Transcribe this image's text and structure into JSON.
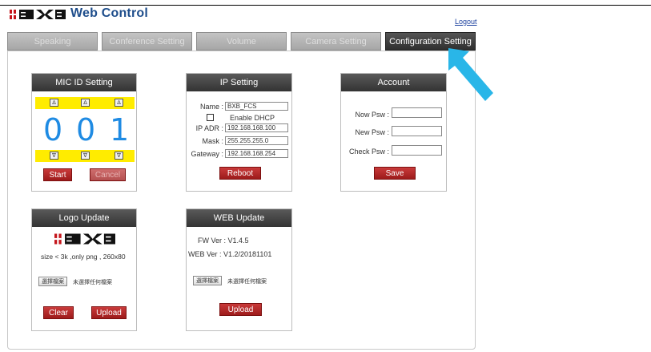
{
  "header": {
    "brand_text": "Web Control",
    "logout_label": "Logout",
    "logo_letters": "BXB"
  },
  "tabs": [
    {
      "label": "Speaking",
      "active": false
    },
    {
      "label": "Conference Setting",
      "active": false
    },
    {
      "label": "Volume",
      "active": false
    },
    {
      "label": "Camera Setting",
      "active": false
    },
    {
      "label": "Configuration Setting",
      "active": true
    }
  ],
  "mic_id": {
    "title": "MIC ID Setting",
    "digits": [
      "0",
      "0",
      "1"
    ],
    "up_symbol": "∆",
    "down_symbol": "∇",
    "start_label": "Start",
    "cancel_label": "Cancel"
  },
  "ip": {
    "title": "IP Setting",
    "name_label": "Name :",
    "name_value": "BXB_FCS",
    "dhcp_label": "Enable DHCP",
    "ip_label": "IP ADR :",
    "ip_value": "192.168.168.100",
    "mask_label": "Mask :",
    "mask_value": "255.255.255.0",
    "gateway_label": "Gateway :",
    "gateway_value": "192.168.168.254",
    "reboot_label": "Reboot"
  },
  "account": {
    "title": "Account",
    "now_label": "Now Psw :",
    "new_label": "New Psw :",
    "check_label": "Check Psw :",
    "save_label": "Save"
  },
  "logo_update": {
    "title": "Logo Update",
    "hint": "size < 3k ,only png , 260x80",
    "file_button": "選擇檔案",
    "file_status": "未選擇任何檔案",
    "clear_label": "Clear",
    "upload_label": "Upload"
  },
  "web_update": {
    "title": "WEB Update",
    "fw_ver": "FW Ver : V1.4.5",
    "web_ver": "WEB Ver : V1.2/20181101",
    "file_button": "選擇檔案",
    "file_status": "未選擇任何檔案",
    "upload_label": "Upload"
  },
  "colors": {
    "accent_blue": "#1f8be3",
    "button_red": "#b52a2a",
    "yellow_bar": "#ffec00",
    "pointer_cyan": "#29b6e8"
  }
}
